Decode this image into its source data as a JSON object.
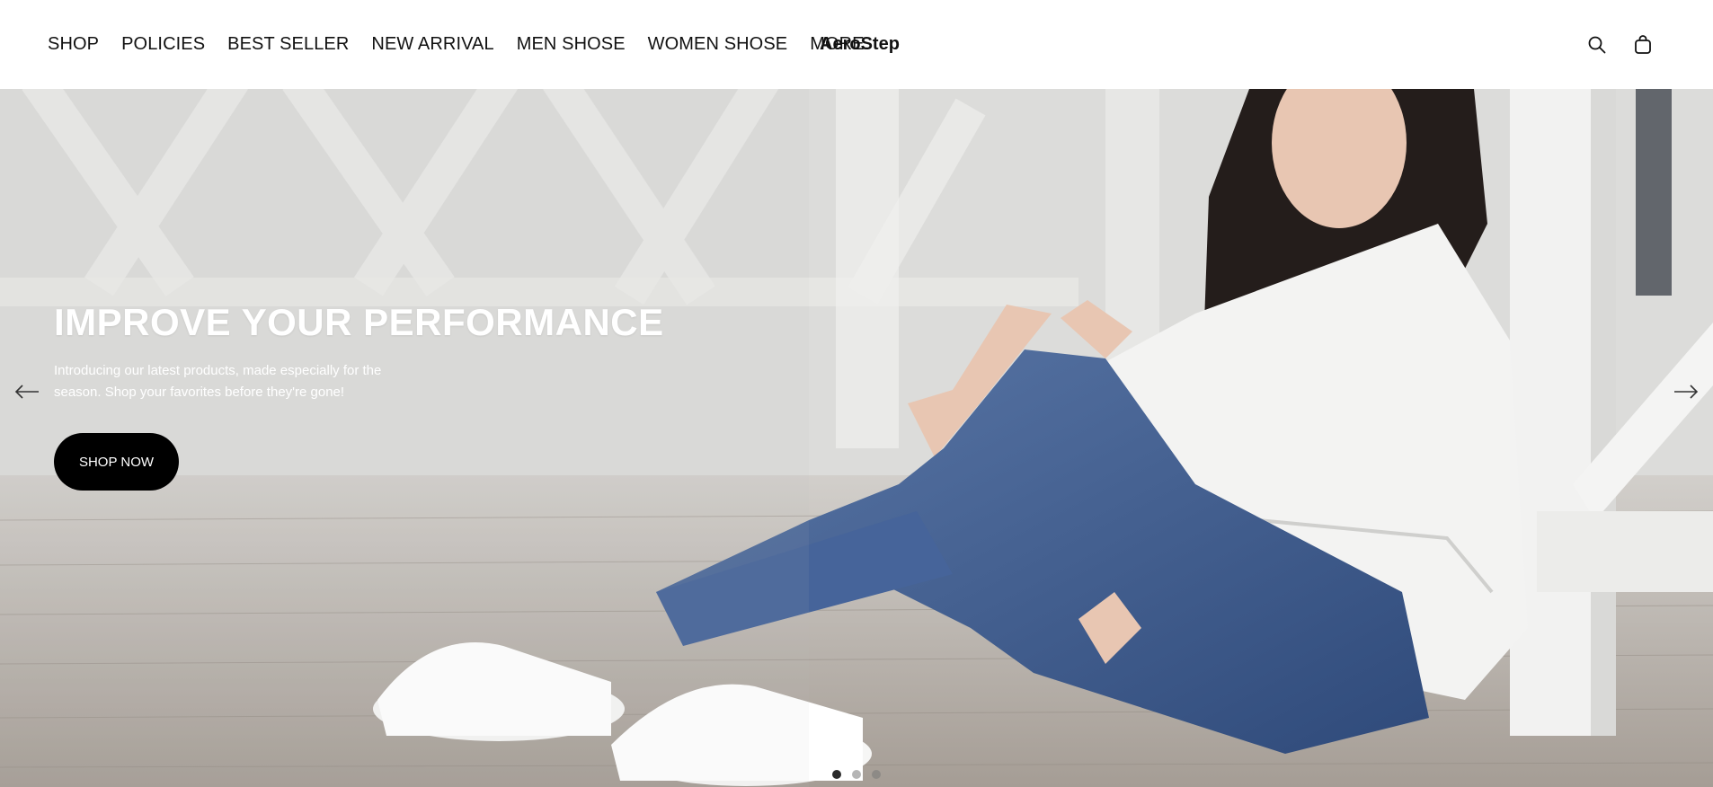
{
  "header": {
    "nav_items": [
      {
        "label": "SHOP"
      },
      {
        "label": "POLICIES"
      },
      {
        "label": "BEST SELLER"
      },
      {
        "label": "NEW ARRIVAL"
      },
      {
        "label": "MEN SHOSE"
      },
      {
        "label": "WOMEN SHOSE"
      },
      {
        "label": "MORE"
      }
    ],
    "brand": "AeroStep",
    "icons": [
      "search-icon",
      "shopping-bag-icon"
    ]
  },
  "hero": {
    "title": "IMPROVE YOUR PERFORMANCE",
    "subtitle": "Introducing our latest products, made especially for the season. Shop your favorites before they're gone!",
    "button_label": "SHOP NOW",
    "slides_total": 3,
    "active_slide": 1,
    "image_description_icon": "photo-woman-sneakers"
  },
  "colors": {
    "header_bg": "#ffffff",
    "button_bg": "#000000",
    "button_text": "#ffffff",
    "hero_text": "#ffffff"
  }
}
